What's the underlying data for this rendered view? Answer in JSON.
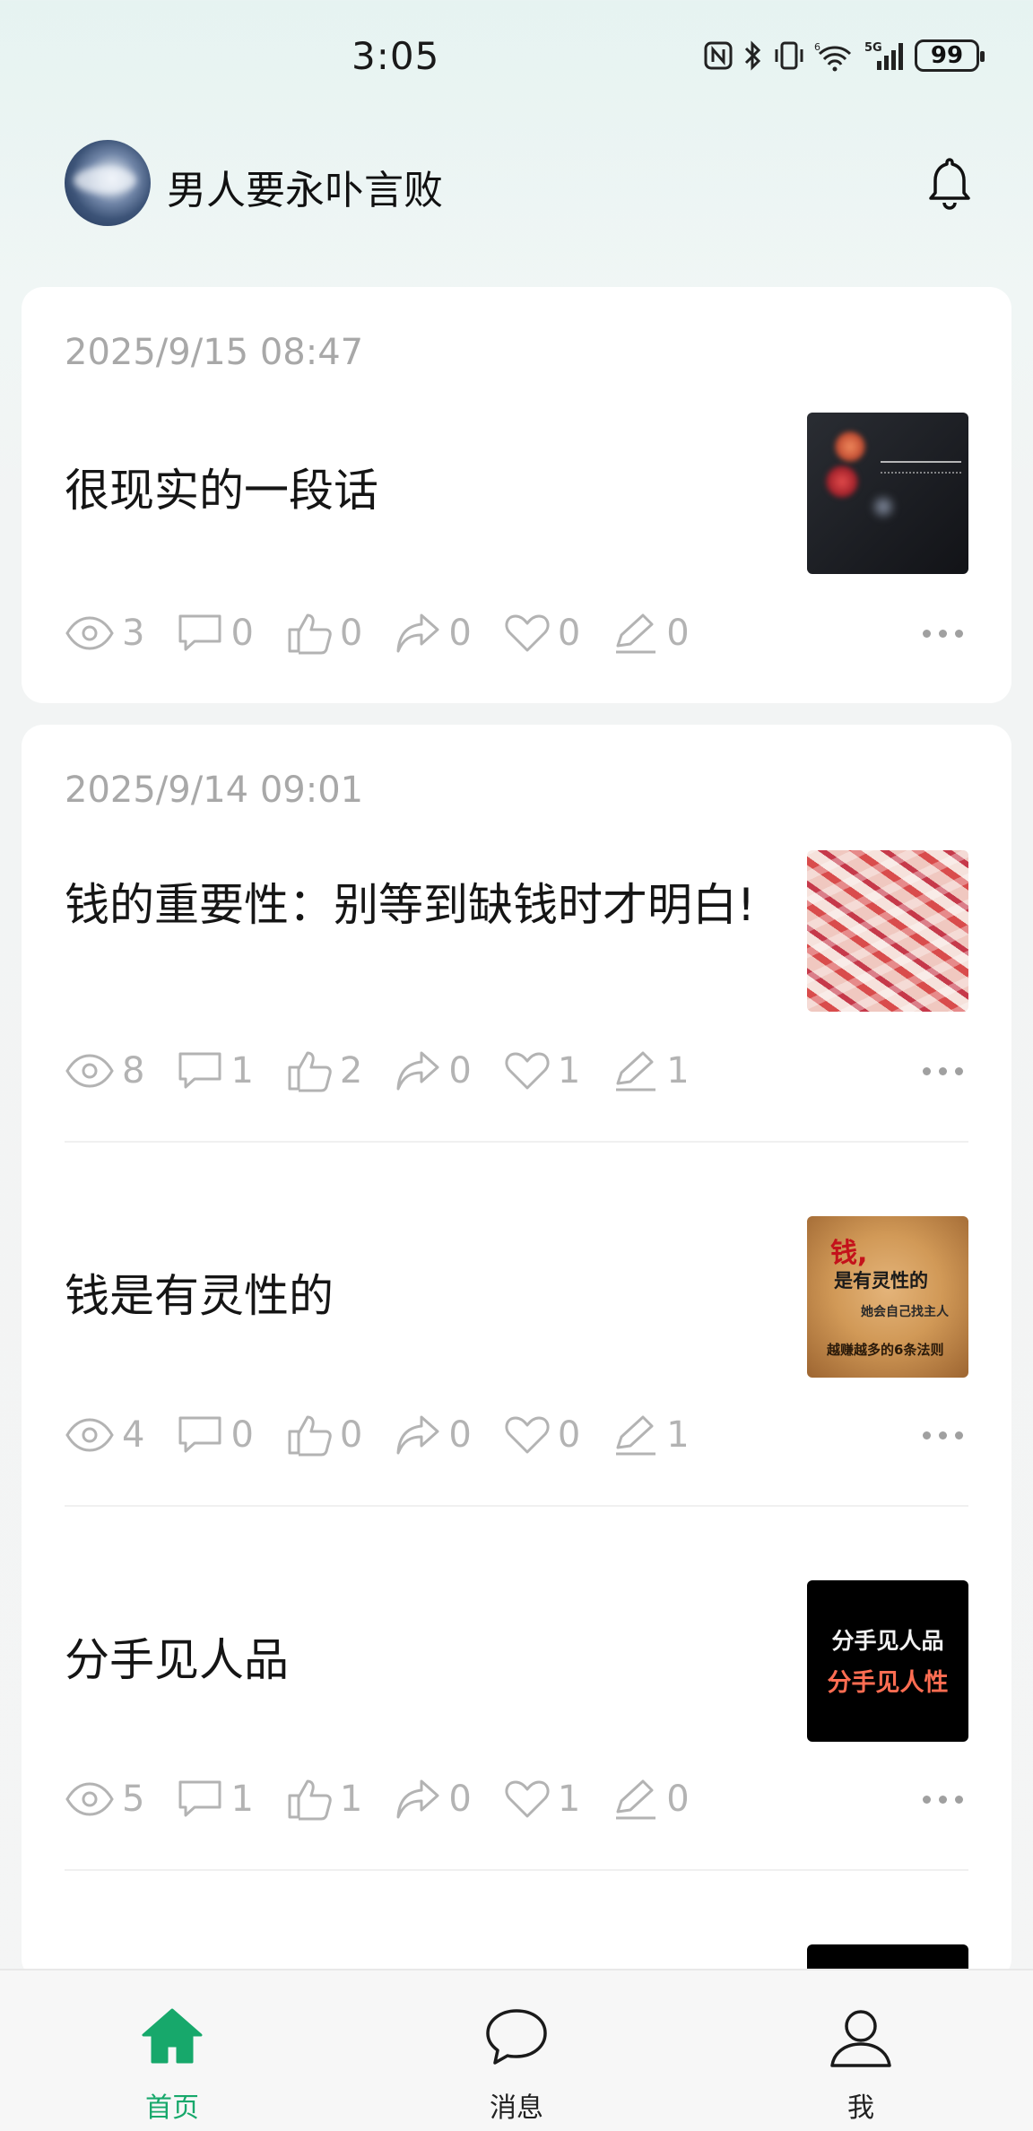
{
  "status_bar": {
    "time": "3:05",
    "battery": "99",
    "network": "5G"
  },
  "header": {
    "username": "男人要永卟言败"
  },
  "posts": [
    {
      "date": "2025/9/15 08:47",
      "title": "很现实的一段话",
      "stats": {
        "views": "3",
        "comments": "0",
        "likes": "0",
        "shares": "0",
        "favorites": "0",
        "edits": "0"
      }
    },
    {
      "date": "2025/9/14 09:01",
      "title": "钱的重要性：别等到缺钱时才明白!",
      "stats": {
        "views": "8",
        "comments": "1",
        "likes": "2",
        "shares": "0",
        "favorites": "1",
        "edits": "1"
      }
    },
    {
      "title": "钱是有灵性的",
      "stats": {
        "views": "4",
        "comments": "0",
        "likes": "0",
        "shares": "0",
        "favorites": "0",
        "edits": "1"
      },
      "thumb_text": [
        "钱,",
        "是有灵性的",
        "她会自己找主人",
        "越赚越多的6条法则"
      ]
    },
    {
      "title": "分手见人品",
      "stats": {
        "views": "5",
        "comments": "1",
        "likes": "1",
        "shares": "0",
        "favorites": "1",
        "edits": "0"
      },
      "thumb_text": [
        "分手见人品",
        "分手见人性"
      ]
    }
  ],
  "tabs": [
    {
      "label": "首页",
      "icon": "home-icon",
      "active": true
    },
    {
      "label": "消息",
      "icon": "message-icon",
      "active": false
    },
    {
      "label": "我",
      "icon": "person-icon",
      "active": false
    }
  ],
  "colors": {
    "accent": "#17a86b",
    "muted": "#b3b3b3"
  }
}
